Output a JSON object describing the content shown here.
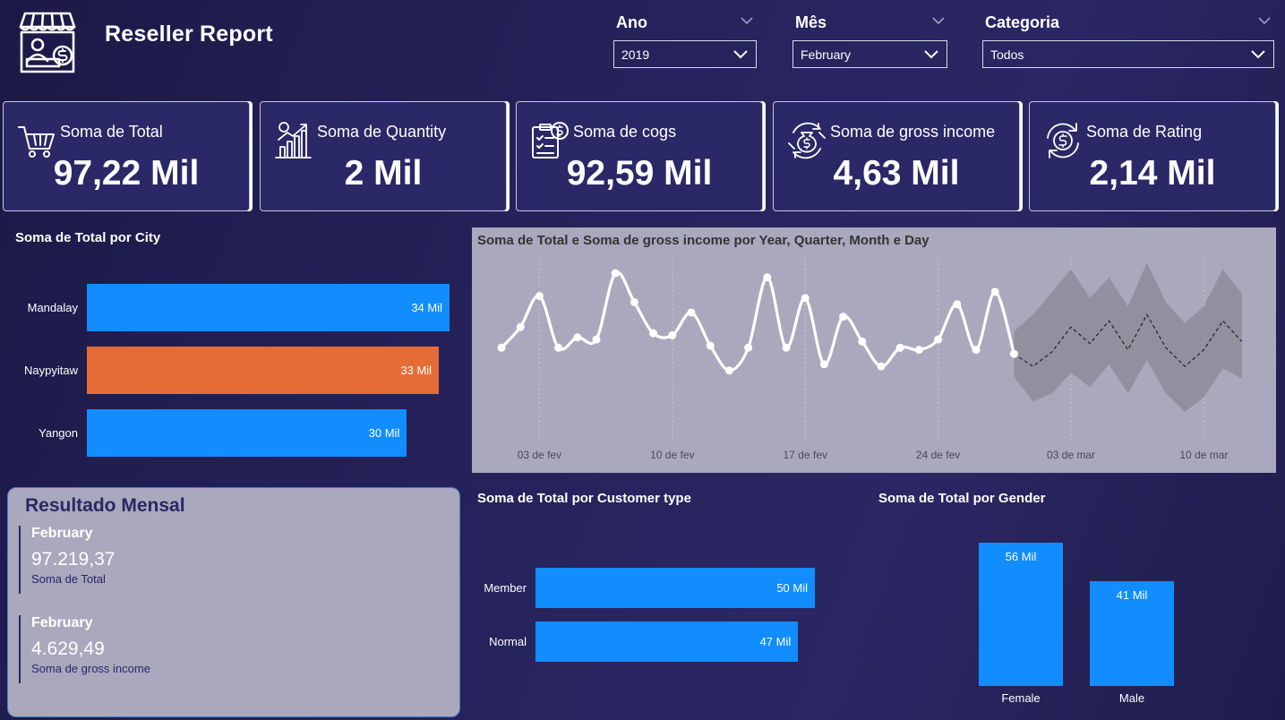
{
  "header": {
    "title": "Reseller Report",
    "logo_icon": "store-seller-icon"
  },
  "filters": {
    "ano": {
      "label": "Ano",
      "value": "2019"
    },
    "mes": {
      "label": "Mês",
      "value": "February"
    },
    "categoria": {
      "label": "Categoria",
      "value": "Todos"
    }
  },
  "kpis": [
    {
      "label": "Soma de Total",
      "value": "97,22 Mil",
      "icon": "shopping-cart-icon"
    },
    {
      "label": "Soma de Quantity",
      "value": "2 Mil",
      "icon": "growth-chart-icon"
    },
    {
      "label": "Soma de cogs",
      "value": "92,59 Mil",
      "icon": "checklist-dollar-icon"
    },
    {
      "label": "Soma de gross income",
      "value": "4,63 Mil",
      "icon": "money-bag-cycle-icon"
    },
    {
      "label": "Soma de Rating",
      "value": "2,14 Mil",
      "icon": "refresh-dollar-icon"
    }
  ],
  "city_chart": {
    "title": "Soma de Total por City",
    "chart_data": {
      "type": "bar",
      "orientation": "horizontal",
      "categories": [
        "Mandalay",
        "Naypyitaw",
        "Yangon"
      ],
      "values": [
        34,
        33,
        30
      ],
      "labels": [
        "34 Mil",
        "33 Mil",
        "30 Mil"
      ],
      "colors": [
        "#118dff",
        "#e66c37",
        "#118dff"
      ]
    }
  },
  "line_chart": {
    "title": "Soma de Total e Soma de gross income por Year, Quarter, Month e Day",
    "x_ticks": [
      "03 de fev",
      "10 de fev",
      "17 de fev",
      "24 de fev",
      "03 de mar",
      "10 de mar"
    ],
    "chart_data": {
      "type": "line",
      "x": [
        "01 fev",
        "02 fev",
        "03 fev",
        "04 fev",
        "05 fev",
        "06 fev",
        "07 fev",
        "08 fev",
        "09 fev",
        "10 fev",
        "11 fev",
        "12 fev",
        "13 fev",
        "14 fev",
        "15 fev",
        "16 fev",
        "17 fev",
        "18 fev",
        "19 fev",
        "20 fev",
        "21 fev",
        "22 fev",
        "23 fev",
        "24 fev",
        "25 fev",
        "26 fev",
        "27 fev",
        "28 fev"
      ],
      "values": [
        4.4,
        5.4,
        6.9,
        4.4,
        4.9,
        4.8,
        8.0,
        6.6,
        5.1,
        5.0,
        6.1,
        4.5,
        3.3,
        4.4,
        7.8,
        4.4,
        6.8,
        3.6,
        5.9,
        4.7,
        3.5,
        4.4,
        4.3,
        4.8,
        6.5,
        4.3,
        7.1,
        4.1
      ],
      "forecast": [
        4.1,
        3.5,
        4.2,
        5.4,
        4.6,
        5.7,
        4.3,
        6.0,
        4.4,
        3.5,
        4.3,
        5.7,
        4.7
      ],
      "forecast_upper": [
        5.2,
        6.0,
        7.1,
        8.2,
        6.8,
        7.8,
        6.4,
        8.5,
        6.6,
        5.6,
        6.4,
        8.2,
        7.0
      ],
      "forecast_lower": [
        3.0,
        1.8,
        2.2,
        3.2,
        2.5,
        3.6,
        2.2,
        3.8,
        2.2,
        1.3,
        2.0,
        3.4,
        2.9
      ],
      "colors": {
        "line": "#ffffff",
        "forecast_band": "#8d8c99",
        "forecast_line": "#222222",
        "background": "#a9a8bd"
      }
    }
  },
  "result": {
    "title": "Resultado Mensal",
    "items": [
      {
        "month": "February",
        "value": "97.219,37",
        "caption": "Soma de Total"
      },
      {
        "month": "February",
        "value": "4.629,49",
        "caption": "Soma de gross income"
      }
    ]
  },
  "customer_chart": {
    "title": "Soma de Total por Customer type",
    "chart_data": {
      "type": "bar",
      "orientation": "horizontal",
      "categories": [
        "Member",
        "Normal"
      ],
      "values": [
        50,
        47
      ],
      "labels": [
        "50 Mil",
        "47 Mil"
      ],
      "colors": [
        "#118dff",
        "#118dff"
      ]
    }
  },
  "gender_chart": {
    "title": "Soma de Total por Gender",
    "chart_data": {
      "type": "bar",
      "orientation": "vertical",
      "categories": [
        "Female",
        "Male"
      ],
      "values": [
        56,
        41
      ],
      "labels": [
        "56 Mil",
        "41 Mil"
      ],
      "colors": [
        "#118dff",
        "#118dff"
      ]
    }
  }
}
